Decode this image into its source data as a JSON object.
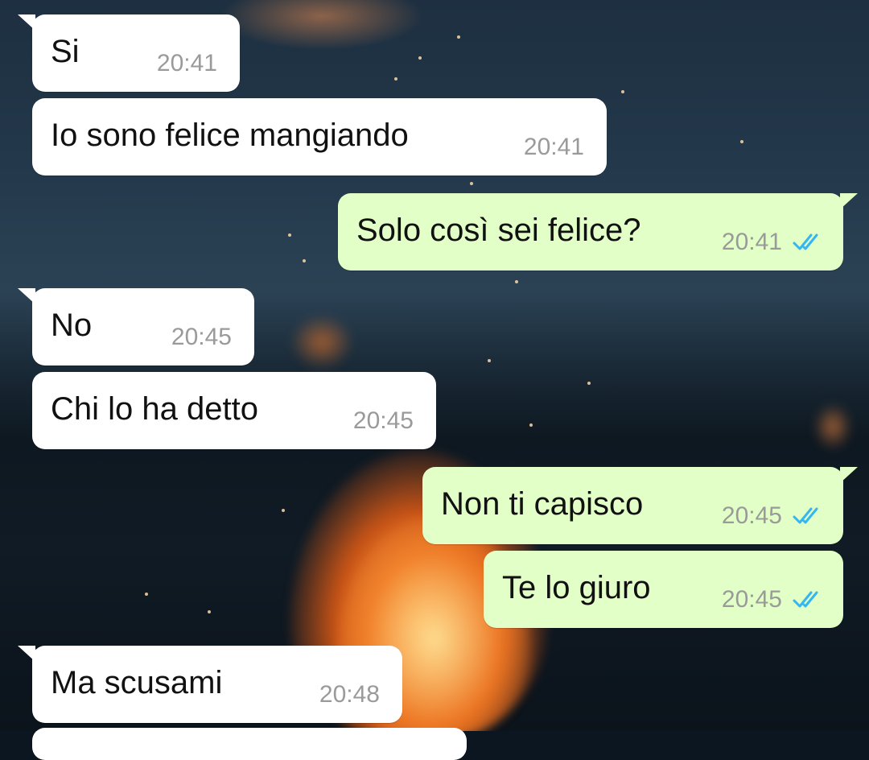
{
  "chat": {
    "messages": [
      {
        "direction": "incoming",
        "text": "Si",
        "time": "20:41"
      },
      {
        "direction": "incoming",
        "text": "Io sono felice mangiando",
        "time": "20:41"
      },
      {
        "direction": "outgoing",
        "text": "Solo così sei felice?",
        "time": "20:41",
        "status": "read-double-check-icon"
      },
      {
        "direction": "incoming",
        "text": "No",
        "time": "20:45"
      },
      {
        "direction": "incoming",
        "text": "Chi lo ha detto",
        "time": "20:45"
      },
      {
        "direction": "outgoing",
        "text": "Non ti capisco",
        "time": "20:45",
        "status": "read-double-check-icon"
      },
      {
        "direction": "outgoing",
        "text": "Te lo giuro",
        "time": "20:45",
        "status": "read-double-check-icon"
      },
      {
        "direction": "incoming",
        "text": "Ma scusami",
        "time": "20:48"
      }
    ]
  },
  "colors": {
    "incoming_bubble": "#ffffff",
    "outgoing_bubble": "#e2ffc7",
    "read_tick": "#34b7f1",
    "timestamp": "#9a9a9a"
  },
  "wallpaper": {
    "description_icon": "campfire-wallpaper"
  }
}
